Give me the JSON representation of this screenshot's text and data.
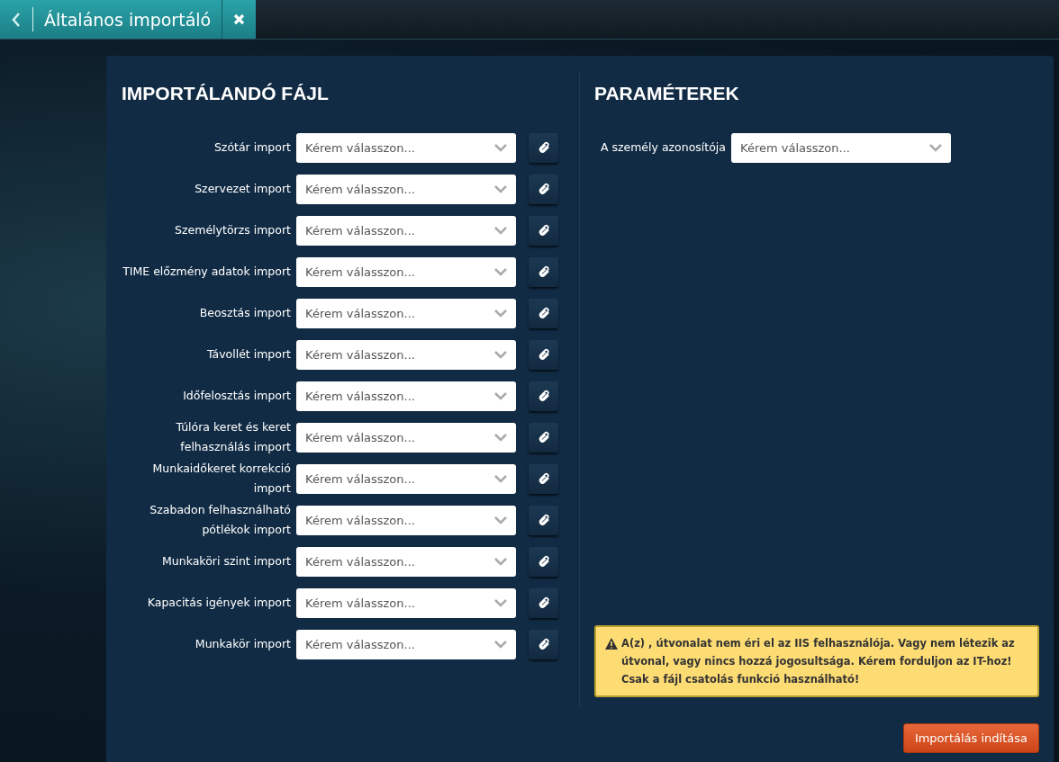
{
  "tab": {
    "title": "Általános importáló"
  },
  "import_section": {
    "title": "IMPORTÁLANDÓ FÁJL",
    "rows": [
      {
        "label": "Szótár import",
        "placeholder": "Kérem válasszon..."
      },
      {
        "label": "Szervezet import",
        "placeholder": "Kérem válasszon..."
      },
      {
        "label": "Személytörzs import",
        "placeholder": "Kérem válasszon..."
      },
      {
        "label": "TIME előzmény adatok import",
        "placeholder": "Kérem válasszon..."
      },
      {
        "label": "Beosztás import",
        "placeholder": "Kérem válasszon..."
      },
      {
        "label": "Távollét import",
        "placeholder": "Kérem válasszon..."
      },
      {
        "label": "Időfelosztás import",
        "placeholder": "Kérem válasszon..."
      },
      {
        "label": "Túlóra keret és keret felhasználás import",
        "placeholder": "Kérem válasszon..."
      },
      {
        "label": "Munkaidőkeret korrekció import",
        "placeholder": "Kérem válasszon..."
      },
      {
        "label": "Szabadon felhasználható pótlékok import",
        "placeholder": "Kérem válasszon..."
      },
      {
        "label": "Munkaköri szint import",
        "placeholder": "Kérem válasszon..."
      },
      {
        "label": "Kapacitás igények import",
        "placeholder": "Kérem válasszon..."
      },
      {
        "label": "Munkakör import",
        "placeholder": "Kérem válasszon..."
      }
    ]
  },
  "parameters": {
    "title": "PARAMÉTEREK",
    "fields": [
      {
        "label": "A személy azonosítója",
        "placeholder": "Kérem válasszon..."
      }
    ]
  },
  "warning": "A(z) , útvonalat nem éri el az IIS felhasználója. Vagy nem létezik az útvonal, vagy nincs hozzá jogosultsága. Kérem forduljon az IT-hoz! Csak a fájl csatolás funkció használható!",
  "start_button": "Importálás indítása"
}
